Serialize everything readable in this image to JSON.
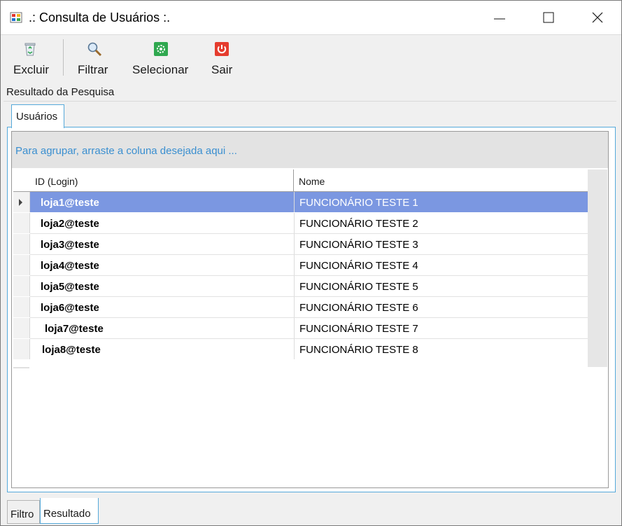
{
  "window": {
    "title": ".: Consulta de Usuários :."
  },
  "toolbar": {
    "excluir": "Excluir",
    "filtrar": "Filtrar",
    "selecionar": "Selecionar",
    "sair": "Sair"
  },
  "group": {
    "label": "Resultado da Pesquisa"
  },
  "inner_tab": {
    "label": "Usuários"
  },
  "grid": {
    "group_hint": "Para agrupar, arraste a coluna desejada aqui ...",
    "columns": {
      "id": "ID (Login)",
      "nome": "Nome"
    },
    "rows": [
      {
        "id": "loja1@teste",
        "nome": "FUNCIONÁRIO TESTE 1"
      },
      {
        "id": "loja2@teste",
        "nome": "FUNCIONÁRIO TESTE 2"
      },
      {
        "id": "loja3@teste",
        "nome": "FUNCIONÁRIO TESTE 3"
      },
      {
        "id": "loja4@teste",
        "nome": "FUNCIONÁRIO TESTE 4"
      },
      {
        "id": "loja5@teste",
        "nome": "FUNCIONÁRIO TESTE 5"
      },
      {
        "id": "loja6@teste",
        "nome": "FUNCIONÁRIO TESTE 6"
      },
      {
        "id": "loja7@teste",
        "nome": "FUNCIONÁRIO TESTE 7"
      },
      {
        "id": "loja8@teste",
        "nome": "FUNCIONÁRIO TESTE 8"
      }
    ],
    "selected_row": 0
  },
  "bottom_tabs": {
    "filtro": "Filtro",
    "resultado": "Resultado"
  },
  "colors": {
    "selection": "#7b97e1",
    "accent_border": "#55a9da",
    "hint_text": "#3a8fd0"
  },
  "icons": {
    "app": "app-window-icon",
    "excluir": "recycle-bin-icon",
    "filtrar": "magnifier-icon",
    "selecionar": "select-gear-icon",
    "sair": "power-icon"
  }
}
